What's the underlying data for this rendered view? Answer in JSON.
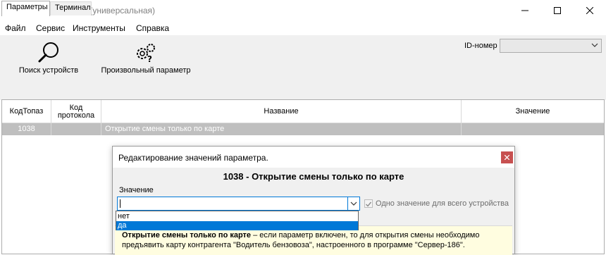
{
  "window": {
    "title": "Настройка Топаз (универсальная)"
  },
  "menu": [
    "Файл",
    "Сервис",
    "Инструменты",
    "Справка"
  ],
  "toolbar": {
    "search_label": "Поиск устройств",
    "param_label": "Произвольный параметр",
    "id_label": "ID-номер",
    "id_value": ""
  },
  "tabs": [
    "Параметры",
    "Терминал"
  ],
  "grid": {
    "headers": [
      "КодТопаз",
      "Код протокола",
      "Название",
      "Значение"
    ],
    "rows": [
      {
        "code": "1038",
        "protocol": "",
        "name": "Открытие смены только по карте",
        "value": ""
      }
    ]
  },
  "dialog": {
    "title": "Редактирование значений параметра.",
    "param_title": "1038 - Открытие смены только по карте",
    "value_label": "Значение",
    "value": "",
    "checkbox_label": "Одно значение для всего устройства",
    "checkbox_checked": true,
    "options": [
      "нет",
      "да"
    ],
    "selected_option": "да",
    "desc_bold": "Открытие смены только по карте",
    "desc_rest": " – если параметр включен, то для открытия смены необходимо",
    "desc_line2": "предъявить карту контрагента \"Водитель бензовоза\", настроенного в программе \"Сервер-186\"."
  },
  "colors": {
    "accent": "#0078d7",
    "row_selected": "#bfbfbf",
    "close_red": "#c75050",
    "hint_bg": "#fffde0"
  }
}
